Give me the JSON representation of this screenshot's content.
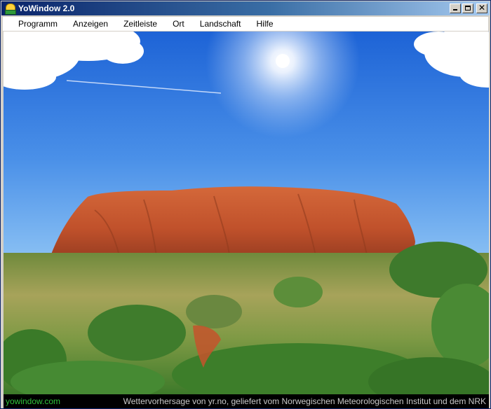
{
  "window": {
    "title": "YoWindow 2.0",
    "buttons": {
      "minimize": "minimize",
      "maximize": "maximize",
      "close": "✕"
    }
  },
  "menu": {
    "items": [
      {
        "label": "Programm"
      },
      {
        "label": "Anzeigen"
      },
      {
        "label": "Zeitleiste"
      },
      {
        "label": "Ort"
      },
      {
        "label": "Landschaft"
      },
      {
        "label": "Hilfe"
      }
    ]
  },
  "status": {
    "left": "yowindow.com",
    "right": "Wettervorhersage von yr.no, geliefert vom Norwegischen Meteorologischen Institut und dem NRK"
  },
  "colors": {
    "title_start": "#0a246a",
    "title_end": "#a6caf0",
    "sky_top": "#1f68d8",
    "sky_bottom": "#7bb7f2",
    "rock": "#c3542c",
    "status_link": "#2fc23a"
  },
  "icons": {
    "app": "yowindow-sun-icon",
    "minimize": "minimize-icon",
    "maximize": "maximize-icon",
    "close": "close-icon"
  }
}
